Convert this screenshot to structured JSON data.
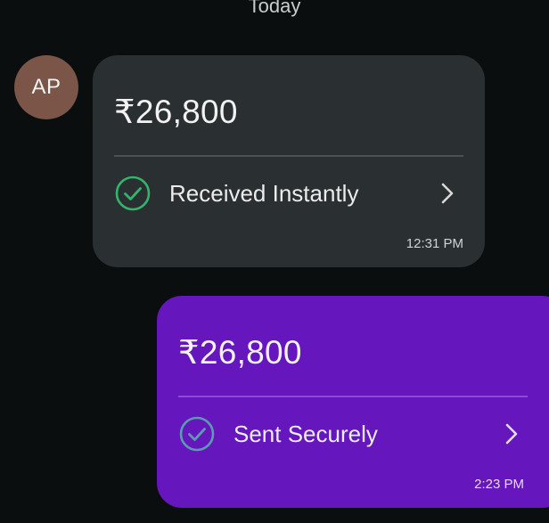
{
  "date_divider": "Today",
  "received": {
    "avatar_initials": "AP",
    "amount": "₹26,800",
    "status": "Received Instantly",
    "time": "12:31 PM",
    "status_icon": "check-circle-icon",
    "status_color": "#34b36a"
  },
  "sent": {
    "amount": "₹26,800",
    "status": "Sent Securely",
    "time": "2:23 PM",
    "status_icon": "check-circle-icon",
    "status_color": "#5a9bb0"
  },
  "colors": {
    "background": "#0b0e0f",
    "received_bubble": "#2a2f31",
    "sent_bubble": "#6516bd",
    "avatar": "#7a5548"
  }
}
